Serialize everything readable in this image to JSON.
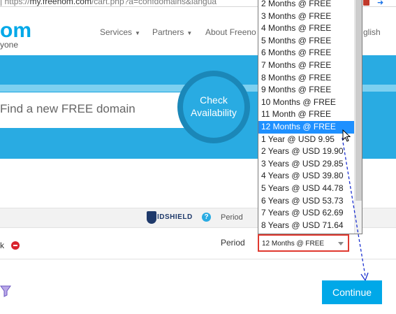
{
  "browser": {
    "url_prefix": "| https://",
    "url_domain": "my.freenom.com",
    "url_path": "/cart.php?a=confdomains&langua"
  },
  "header": {
    "logo_text": "om",
    "logo_sub": "yone",
    "nav": [
      {
        "label": "Services"
      },
      {
        "label": "Partners"
      },
      {
        "label": "About Freeno"
      }
    ],
    "language": "glish"
  },
  "search": {
    "placeholder": "Find a new FREE domain",
    "check_button": [
      "Check",
      "Availability"
    ]
  },
  "table": {
    "idshield_label": "IDSHIELD",
    "help_icon_glyph": "?",
    "period_header": "Period",
    "row_text": "k",
    "period_label": "Period",
    "selected_period": "12 Months @ FREE"
  },
  "dropdown": {
    "options": [
      "2 Months @ FREE",
      "3 Months @ FREE",
      "4 Months @ FREE",
      "5 Months @ FREE",
      "6 Months @ FREE",
      "7 Months @ FREE",
      "8 Months @ FREE",
      "9 Months @ FREE",
      "10 Months @ FREE",
      "11 Month @ FREE",
      "12 Months @ FREE",
      "1 Year @ USD 9.95",
      "2 Years @ USD 19.90",
      "3 Years @ USD 29.85",
      "4 Years @ USD 39.80",
      "5 Years @ USD 44.78",
      "6 Years @ USD 53.73",
      "7 Years @ USD 62.69",
      "8 Years @ USD 71.64"
    ],
    "highlighted_index": 10
  },
  "actions": {
    "continue_label": "Continue"
  },
  "colors": {
    "brand_blue": "#29abe2",
    "highlight": "#1e90ff",
    "select_border": "#e0392f",
    "remove_red": "#d9232d",
    "annotation": "#1a2fd0"
  },
  "icons": {
    "remove": "minus-circle-icon",
    "help": "question-circle-icon",
    "shield": "shield-icon",
    "funnel": "funnel-icon",
    "cursor": "mouse-pointer-icon",
    "caret": "chevron-down-icon"
  }
}
